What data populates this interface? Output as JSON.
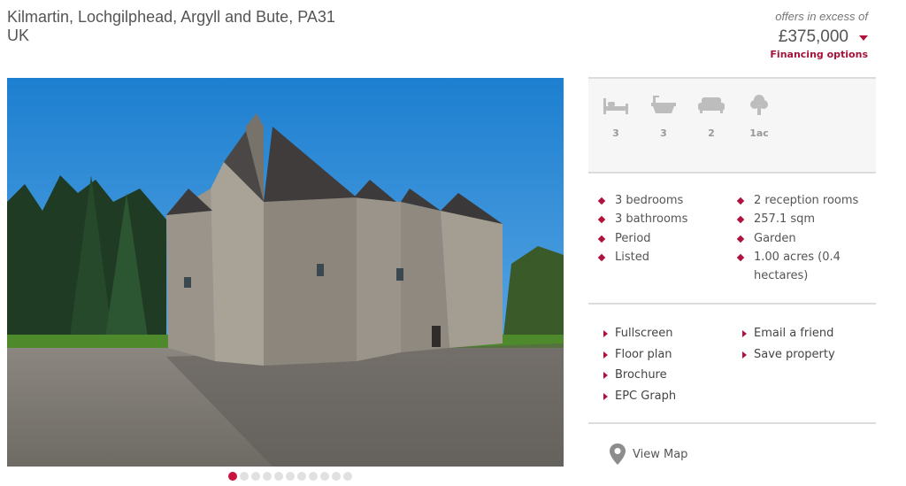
{
  "address": {
    "line1": "Kilmartin, Lochgilphead, Argyll and Bute, PA31",
    "line2": "UK"
  },
  "price": {
    "label": "offers in excess of",
    "value": "£375,000",
    "financing": "Financing options"
  },
  "summary_icons": [
    {
      "icon": "bed-icon",
      "value": "3"
    },
    {
      "icon": "bath-icon",
      "value": "3"
    },
    {
      "icon": "sofa-icon",
      "value": "2"
    },
    {
      "icon": "tree-icon",
      "value": "1ac"
    }
  ],
  "features_left": [
    "3 bedrooms",
    "3 bathrooms",
    "Period",
    "Listed"
  ],
  "features_right": [
    "2 reception rooms",
    "257.1 sqm",
    "Garden",
    "1.00 acres (0.4",
    "hectares)"
  ],
  "links_left": [
    "Fullscreen",
    "Floor plan",
    "Brochure",
    "EPC Graph"
  ],
  "links_right": [
    "Email a friend",
    "Save property"
  ],
  "map_link": "View Map",
  "gallery": {
    "total_images": 11,
    "active_index": 0
  },
  "colors": {
    "accent": "#b0123d",
    "text": "#555555",
    "panel_bg": "#f6f6f6",
    "divider": "#dcdcdc"
  }
}
